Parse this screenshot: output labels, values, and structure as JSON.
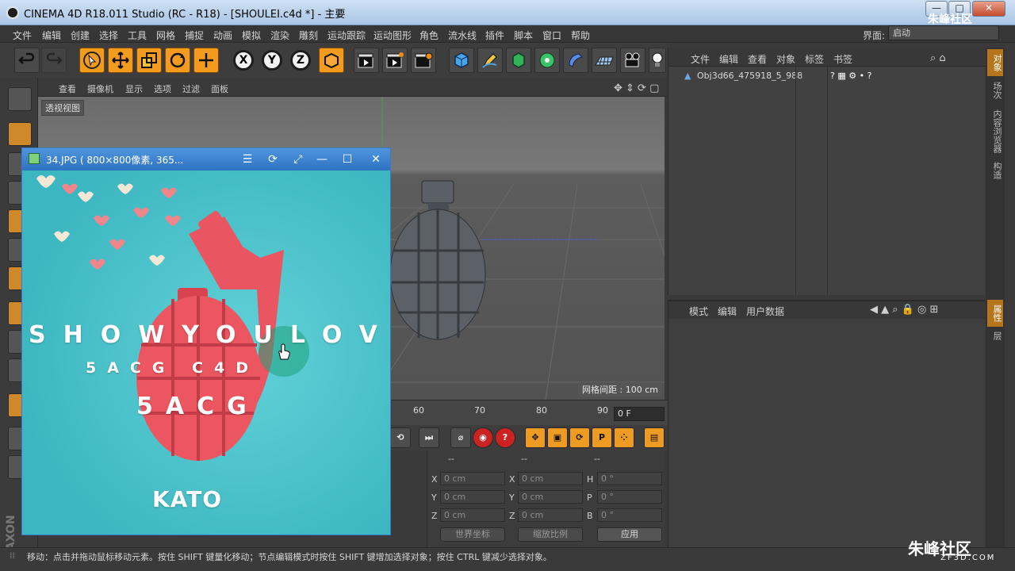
{
  "window": {
    "title": "CINEMA 4D R18.011 Studio (RC - R18) - [SHOULEI.c4d *] - 主要",
    "min": "—",
    "max": "□",
    "close": "✕"
  },
  "menubar": {
    "items": [
      "文件",
      "编辑",
      "创建",
      "选择",
      "工具",
      "网格",
      "捕捉",
      "动画",
      "模拟",
      "渲染",
      "雕刻",
      "运动跟踪",
      "运动图形",
      "角色",
      "流水线",
      "插件",
      "脚本",
      "窗口",
      "帮助"
    ],
    "interface_label": "界面:",
    "interface_value": "启动"
  },
  "viewport": {
    "menu": [
      "查看",
      "摄像机",
      "显示",
      "选项",
      "过滤",
      "面板"
    ],
    "view_name": "透视视图",
    "grid_readout": "网格间距 : 100 cm"
  },
  "timeline": {
    "ticks": [
      "60",
      "70",
      "80",
      "90"
    ],
    "frame": "0 F"
  },
  "coords": {
    "headers": [
      "--",
      "--",
      "--"
    ],
    "rows": [
      {
        "a": "X",
        "av": "0 cm",
        "b": "X",
        "bv": "0 cm",
        "c": "H",
        "cv": "0 °"
      },
      {
        "a": "Y",
        "av": "0 cm",
        "b": "Y",
        "bv": "0 cm",
        "c": "P",
        "cv": "0 °"
      },
      {
        "a": "Z",
        "av": "0 cm",
        "b": "Z",
        "bv": "0 cm",
        "c": "B",
        "cv": "0 °"
      }
    ],
    "world": "世界坐标",
    "scale": "缩放比例",
    "apply": "应用"
  },
  "object_manager": {
    "menu": [
      "文件",
      "编辑",
      "查看",
      "对象",
      "标签",
      "书签"
    ],
    "object_name": "Obj3d66_475918_5_988"
  },
  "attribute_manager": {
    "menu": [
      "模式",
      "编辑",
      "用户数据"
    ]
  },
  "right_tabs": [
    "对象",
    "场次",
    "内容浏览器",
    "构造",
    "属性",
    "层"
  ],
  "status": "移动：点击并拖动鼠标移动元素。按住 SHIFT 键量化移动；节点编辑模式时按住 SHIFT 键增加选择对象；按住 CTRL 键减少选择对象。",
  "photo_viewer": {
    "title": "34.JPG ( 800×800像素, 365...",
    "line1": "SHOWYOULOVE",
    "line2": "5ACG  C4D",
    "line3": "5ACG",
    "line4": "KATO"
  },
  "watermark": {
    "brand": "朱峰社区",
    "site": "ZF3D.COM"
  },
  "colors": {
    "accent": "#f39b1e",
    "window_blue": "#2e73c2",
    "teal": "#53c6cf",
    "grenade_red": "#e8505a"
  }
}
